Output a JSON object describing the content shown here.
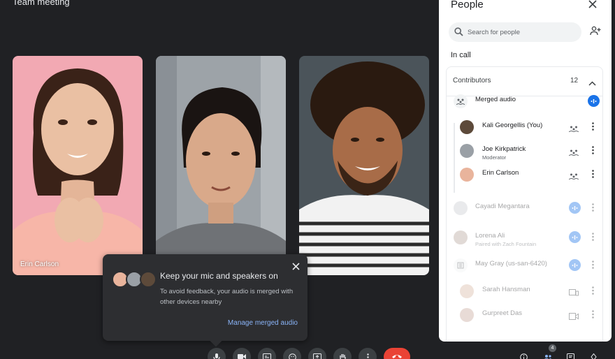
{
  "meeting": {
    "title": "Team meeting"
  },
  "tiles": [
    {
      "name": "Erin Carlson",
      "bg": "#f0a7b0"
    },
    {
      "name": "",
      "bg": "#9ea3a8"
    },
    {
      "name": "",
      "bg": "#4a5258"
    }
  ],
  "popup": {
    "title": "Keep your mic and speakers on",
    "body": "To avoid feedback, your audio is merged with other devices nearby",
    "link": "Manage merged audio"
  },
  "controls": [
    {
      "icon": "mic-icon",
      "label": "Microphone"
    },
    {
      "icon": "camera-icon",
      "label": "Camera"
    },
    {
      "icon": "captions-icon",
      "label": "Captions"
    },
    {
      "icon": "emoji-icon",
      "label": "Reactions"
    },
    {
      "icon": "present-icon",
      "label": "Present"
    },
    {
      "icon": "raise-hand-icon",
      "label": "Raise hand"
    },
    {
      "icon": "more-vert-icon",
      "label": "More options"
    },
    {
      "icon": "end-call-icon",
      "label": "Leave call"
    }
  ],
  "right_controls": {
    "people_count": "4"
  },
  "panel": {
    "title": "People",
    "search_placeholder": "Search for people",
    "in_call": "In call",
    "contributors_label": "Contributors",
    "contributors_count": "12",
    "merged_label": "Merged audio",
    "merged_members": [
      {
        "name": "Kali Georgellis (You)",
        "sub": ""
      },
      {
        "name": "Joe Kirkpatrick",
        "sub": "Moderator"
      },
      {
        "name": "Erin Carlson",
        "sub": ""
      }
    ],
    "others": [
      {
        "name": "Cayadi Megantara",
        "sub": ""
      },
      {
        "name": "Lorena Ali",
        "sub": "Paired with  Zach Fountain"
      },
      {
        "name": "May Gray (us-san-6420)",
        "sub": ""
      },
      {
        "name": "Sarah Hansman",
        "sub": ""
      },
      {
        "name": "Gurpreet Das",
        "sub": ""
      }
    ]
  },
  "colors": {
    "accent": "#1a73e8",
    "end_call": "#ea4335",
    "link": "#8ab4f8",
    "background": "#202124"
  }
}
